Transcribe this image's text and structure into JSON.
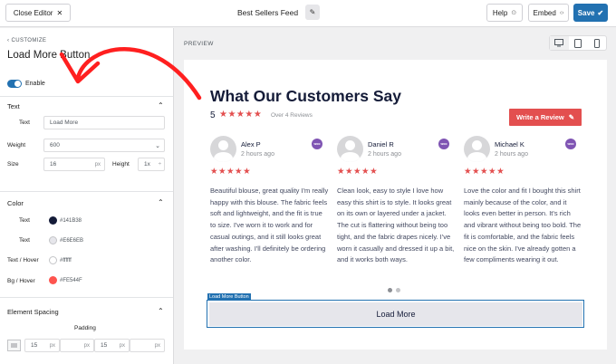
{
  "topbar": {
    "close_label": "Close Editor",
    "close_icon": "close-icon",
    "feed_title": "Best Sellers Feed",
    "help_label": "Help",
    "embed_label": "Embed",
    "save_label": "Save"
  },
  "sidebar": {
    "breadcrumb": "CUSTOMIZE",
    "title": "Load More Button",
    "enable_label": "Enable",
    "enabled": true,
    "text_section": {
      "heading": "Text",
      "text_label": "Text",
      "text_value": "Load More",
      "weight_label": "Weight",
      "weight_value": "600",
      "size_label": "Size",
      "size_value": "16",
      "size_unit": "px",
      "height_label": "Height",
      "height_value": "1x"
    },
    "color_section": {
      "heading": "Color",
      "rows": [
        {
          "label": "Text",
          "hex": "#141B38",
          "color": "#141b38"
        },
        {
          "label": "Text",
          "hex": "#E6E6EB",
          "color": "#e6e6eb"
        },
        {
          "label": "Text / Hover",
          "hex": "#ffffff",
          "color": "#ffffff"
        },
        {
          "label": "Bg / Hover",
          "hex": "#FE544F",
          "color": "#fe544f"
        }
      ]
    },
    "spacing_section": {
      "heading": "Element Spacing",
      "padding_label": "Padding",
      "padding_values": [
        "15",
        "",
        "15",
        ""
      ],
      "unit": "px"
    }
  },
  "canvas": {
    "preview_label": "PREVIEW",
    "devices": [
      "desktop-icon",
      "tablet-icon",
      "mobile-icon"
    ],
    "active_device": "desktop"
  },
  "feed": {
    "heading": "What Our Customers Say",
    "rating": "5",
    "stars": "★★★★★",
    "reviews_count": "Over 4 Reviews",
    "write_review_label": "Write a Review",
    "reviews": [
      {
        "name": "Alex P",
        "time": "2 hours ago",
        "stars": "★★★★★",
        "text": "Beautiful blouse, great quality I'm really happy with this blouse. The fabric feels soft and lightweight, and the fit is true to size. I've worn it to work and for casual outings, and it still looks great after washing. I'll definitely be ordering another color."
      },
      {
        "name": "Daniel R",
        "time": "2 hours ago",
        "stars": "★★★★★",
        "text": "Clean look, easy to style I love how easy this shirt is to style. It looks great on its own or layered under a jacket. The cut is flattering without being too tight, and the fabric drapes nicely. I've worn it casually and dressed it up a bit, and it works both ways."
      },
      {
        "name": "Michael K",
        "time": "2 hours ago",
        "stars": "★★★★★",
        "text": "Love the color and fit I bought this shirt mainly because of the color, and it looks even better in person. It's rich and vibrant without being too bold. The fit is comfortable, and the fabric feels nice on the skin. I've already gotten a few compliments wearing it out."
      }
    ],
    "woo_badge": "woo",
    "selection_tag": "Load More Button",
    "load_more_label": "Load More"
  }
}
